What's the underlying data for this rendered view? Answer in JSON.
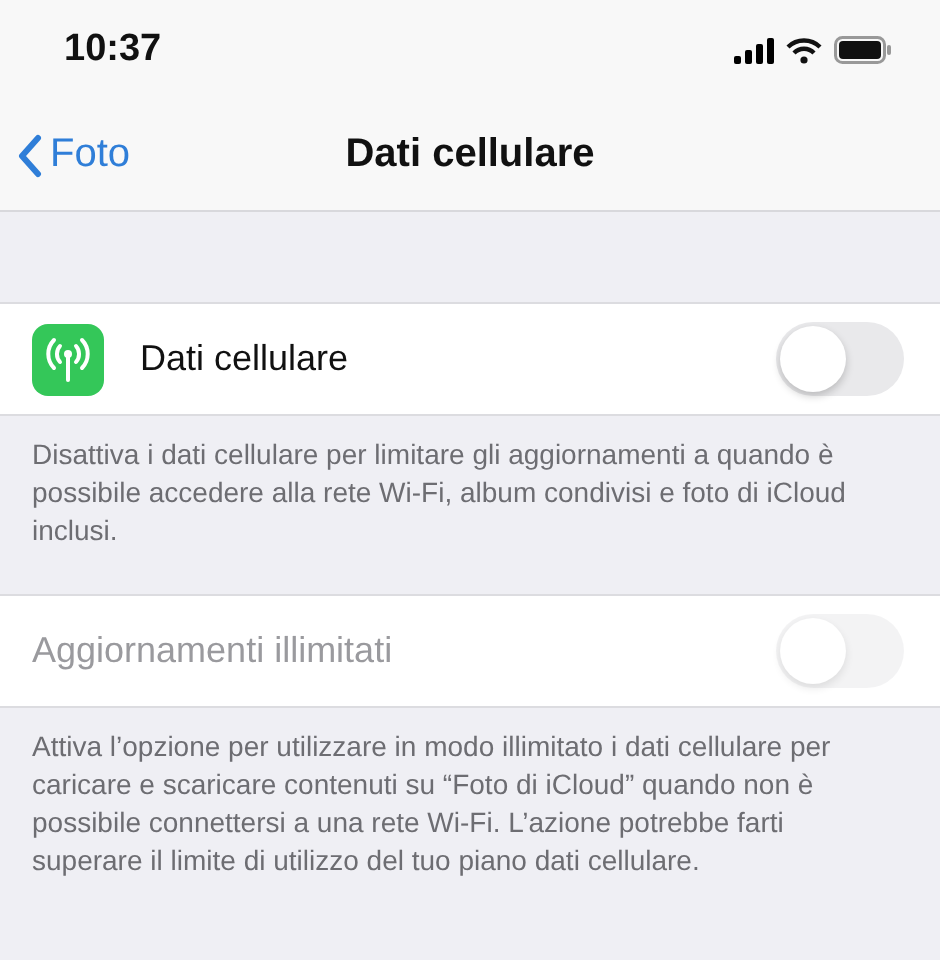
{
  "status_bar": {
    "time": "10:37"
  },
  "nav": {
    "back": "Foto",
    "title": "Dati cellulare"
  },
  "sections": [
    {
      "row": {
        "label": "Dati cellulare",
        "icon": true,
        "on": false,
        "disabled": false
      },
      "footer": "Disattiva i dati cellulare per limitare gli aggiornamenti a quando è possibile accedere alla rete Wi-Fi, album condivisi e foto di iCloud inclusi."
    },
    {
      "row": {
        "label": "Aggiornamenti illimitati",
        "icon": false,
        "on": false,
        "disabled": true
      },
      "footer": "Attiva l’opzione per utilizzare in modo illimitato i dati cellulare per caricare e scaricare contenuti su “Foto di iCloud” quando non è possibile connettersi a una rete Wi-Fi. L’azione potrebbe farti superare il limite di utilizzo del tuo piano dati cellulare."
    }
  ]
}
